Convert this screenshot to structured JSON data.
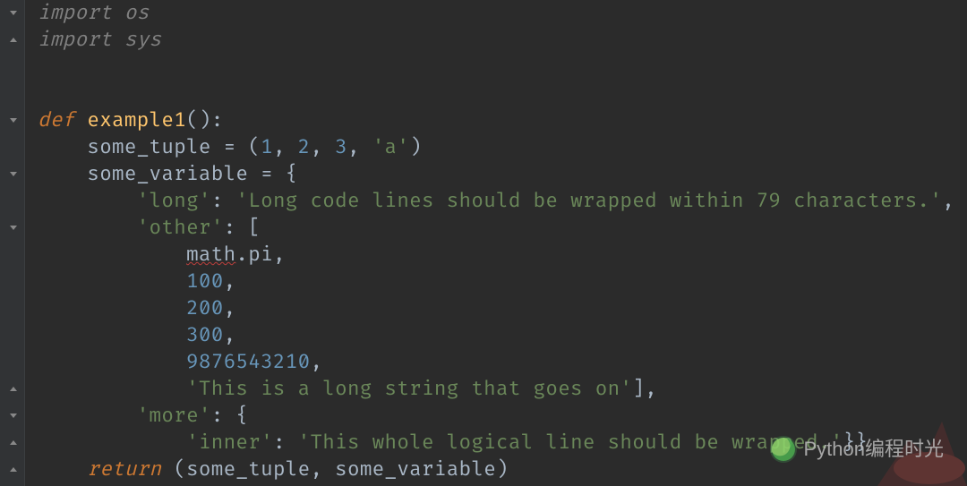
{
  "code": {
    "lines": [
      {
        "tokens": [
          {
            "t": "import ",
            "c": "kw dim"
          },
          {
            "t": "os",
            "c": "dim"
          }
        ]
      },
      {
        "tokens": [
          {
            "t": "import ",
            "c": "kw dim"
          },
          {
            "t": "sys",
            "c": "dim"
          }
        ]
      },
      {
        "tokens": [
          {
            "t": "",
            "c": "ident"
          }
        ]
      },
      {
        "tokens": [
          {
            "t": "",
            "c": "ident"
          }
        ]
      },
      {
        "tokens": [
          {
            "t": "def ",
            "c": "kw"
          },
          {
            "t": "example1",
            "c": "fn"
          },
          {
            "t": "():",
            "c": "punc"
          }
        ]
      },
      {
        "tokens": [
          {
            "t": "    some_tuple ",
            "c": "ident"
          },
          {
            "t": "= (",
            "c": "op"
          },
          {
            "t": "1",
            "c": "num"
          },
          {
            "t": ", ",
            "c": "punc"
          },
          {
            "t": "2",
            "c": "num"
          },
          {
            "t": ", ",
            "c": "punc"
          },
          {
            "t": "3",
            "c": "num"
          },
          {
            "t": ", ",
            "c": "punc"
          },
          {
            "t": "'a'",
            "c": "str"
          },
          {
            "t": ")",
            "c": "punc"
          }
        ]
      },
      {
        "tokens": [
          {
            "t": "    some_variable ",
            "c": "ident"
          },
          {
            "t": "= ",
            "c": "op"
          },
          {
            "t": "{",
            "c": "punc"
          }
        ]
      },
      {
        "tokens": [
          {
            "t": "        ",
            "c": "ident"
          },
          {
            "t": "'long'",
            "c": "str"
          },
          {
            "t": ": ",
            "c": "punc"
          },
          {
            "t": "'Long code lines should be wrapped within 79 characters.'",
            "c": "str"
          },
          {
            "t": ",",
            "c": "punc"
          }
        ]
      },
      {
        "tokens": [
          {
            "t": "        ",
            "c": "ident"
          },
          {
            "t": "'other'",
            "c": "str"
          },
          {
            "t": ": [",
            "c": "punc"
          }
        ]
      },
      {
        "tokens": [
          {
            "t": "            ",
            "c": "ident"
          },
          {
            "t": "math",
            "c": "ident err"
          },
          {
            "t": ".pi",
            "c": "ident"
          },
          {
            "t": ",",
            "c": "punc"
          }
        ]
      },
      {
        "tokens": [
          {
            "t": "            ",
            "c": "ident"
          },
          {
            "t": "100",
            "c": "num"
          },
          {
            "t": ",",
            "c": "punc"
          }
        ]
      },
      {
        "tokens": [
          {
            "t": "            ",
            "c": "ident"
          },
          {
            "t": "200",
            "c": "num"
          },
          {
            "t": ",",
            "c": "punc"
          }
        ]
      },
      {
        "tokens": [
          {
            "t": "            ",
            "c": "ident"
          },
          {
            "t": "300",
            "c": "num"
          },
          {
            "t": ",",
            "c": "punc"
          }
        ]
      },
      {
        "tokens": [
          {
            "t": "            ",
            "c": "ident"
          },
          {
            "t": "9876543210",
            "c": "num"
          },
          {
            "t": ",",
            "c": "punc"
          }
        ]
      },
      {
        "tokens": [
          {
            "t": "            ",
            "c": "ident"
          },
          {
            "t": "'This is a long string that goes on'",
            "c": "str"
          },
          {
            "t": "],",
            "c": "punc"
          }
        ]
      },
      {
        "tokens": [
          {
            "t": "        ",
            "c": "ident"
          },
          {
            "t": "'more'",
            "c": "str"
          },
          {
            "t": ": {",
            "c": "punc"
          }
        ]
      },
      {
        "tokens": [
          {
            "t": "            ",
            "c": "ident"
          },
          {
            "t": "'inner'",
            "c": "str"
          },
          {
            "t": ": ",
            "c": "punc"
          },
          {
            "t": "'This whole logical line should be wrapped.'",
            "c": "str"
          },
          {
            "t": "}}",
            "c": "punc"
          }
        ]
      },
      {
        "tokens": [
          {
            "t": "    ",
            "c": "ident"
          },
          {
            "t": "return ",
            "c": "kw"
          },
          {
            "t": "(some_tuple",
            "c": "ident"
          },
          {
            "t": ", ",
            "c": "punc"
          },
          {
            "t": "some_variable)",
            "c": "ident"
          }
        ]
      }
    ]
  },
  "fold_markers": [
    {
      "row": 0,
      "kind": "expand"
    },
    {
      "row": 1,
      "kind": "collapse"
    },
    {
      "row": 4,
      "kind": "expand"
    },
    {
      "row": 6,
      "kind": "expand"
    },
    {
      "row": 8,
      "kind": "expand"
    },
    {
      "row": 14,
      "kind": "collapse"
    },
    {
      "row": 15,
      "kind": "expand"
    },
    {
      "row": 16,
      "kind": "collapse"
    },
    {
      "row": 17,
      "kind": "collapse"
    }
  ],
  "watermark": {
    "label": "Python编程时光"
  },
  "colors": {
    "background": "#2b2b2b",
    "keyword": "#cc7832",
    "string": "#6a8759",
    "number": "#6897bb",
    "function": "#ffc66d",
    "default": "#a9b7c6",
    "dim": "#808080",
    "error_underline": "#bc3f3c"
  }
}
